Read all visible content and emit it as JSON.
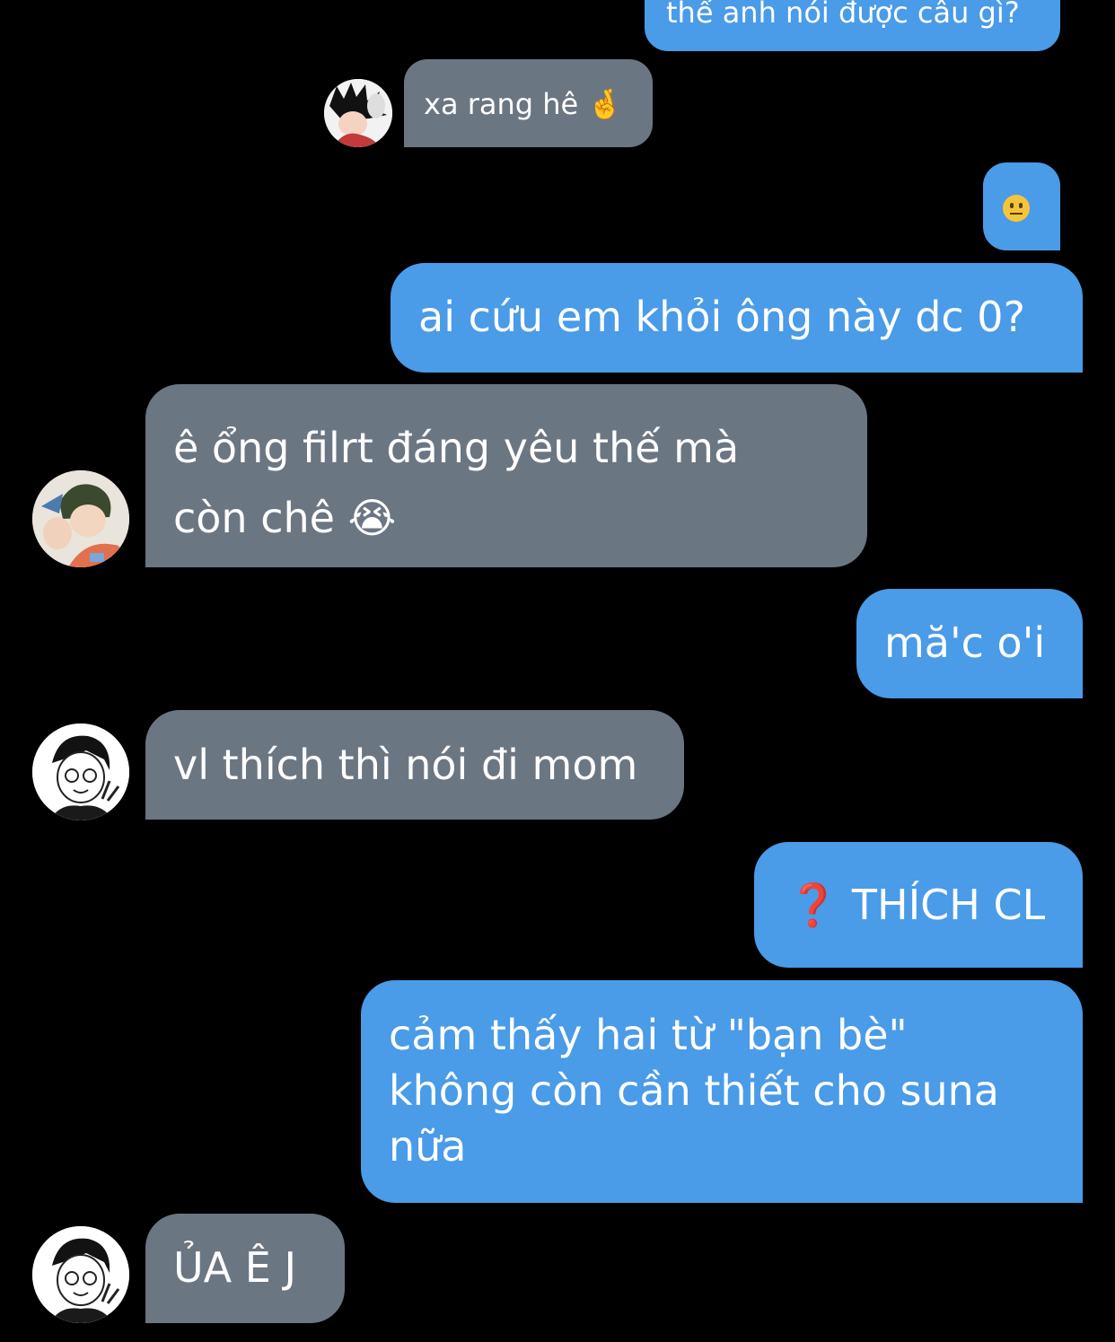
{
  "colors": {
    "background": "#000000",
    "outgoing_bubble": "#4a9be8",
    "incoming_bubble": "#6b7683",
    "text": "#ffffff"
  },
  "messages": [
    {
      "direction": "outgoing",
      "text": "thế anh nói được câu gì?"
    },
    {
      "direction": "incoming",
      "sender_avatar": "avatar-spiky-hair",
      "text": "xa rang hê 🤞"
    },
    {
      "direction": "outgoing",
      "text": "😐",
      "emoji_icon": "neutral-face-emoji"
    },
    {
      "direction": "outgoing",
      "text": "ai cứu em khỏi ông này dc 0?"
    },
    {
      "direction": "incoming",
      "sender_avatar": "avatar-green-hair",
      "lines": [
        "ê ổng filrt đáng yêu thế mà",
        "còn chê 😭"
      ]
    },
    {
      "direction": "outgoing",
      "text": "mă'c o'i"
    },
    {
      "direction": "incoming",
      "sender_avatar": "avatar-glasses-peace",
      "text": "vl thích thì nói đi mom"
    },
    {
      "direction": "outgoing",
      "text": "❓ THÍCH CL"
    },
    {
      "direction": "outgoing",
      "lines": [
        "cảm thấy hai từ \"bạn bè\"",
        "không còn cần thiết cho suna",
        "nữa"
      ]
    },
    {
      "direction": "incoming",
      "sender_avatar": "avatar-glasses-peace",
      "text": "ỦA Ê J"
    }
  ]
}
